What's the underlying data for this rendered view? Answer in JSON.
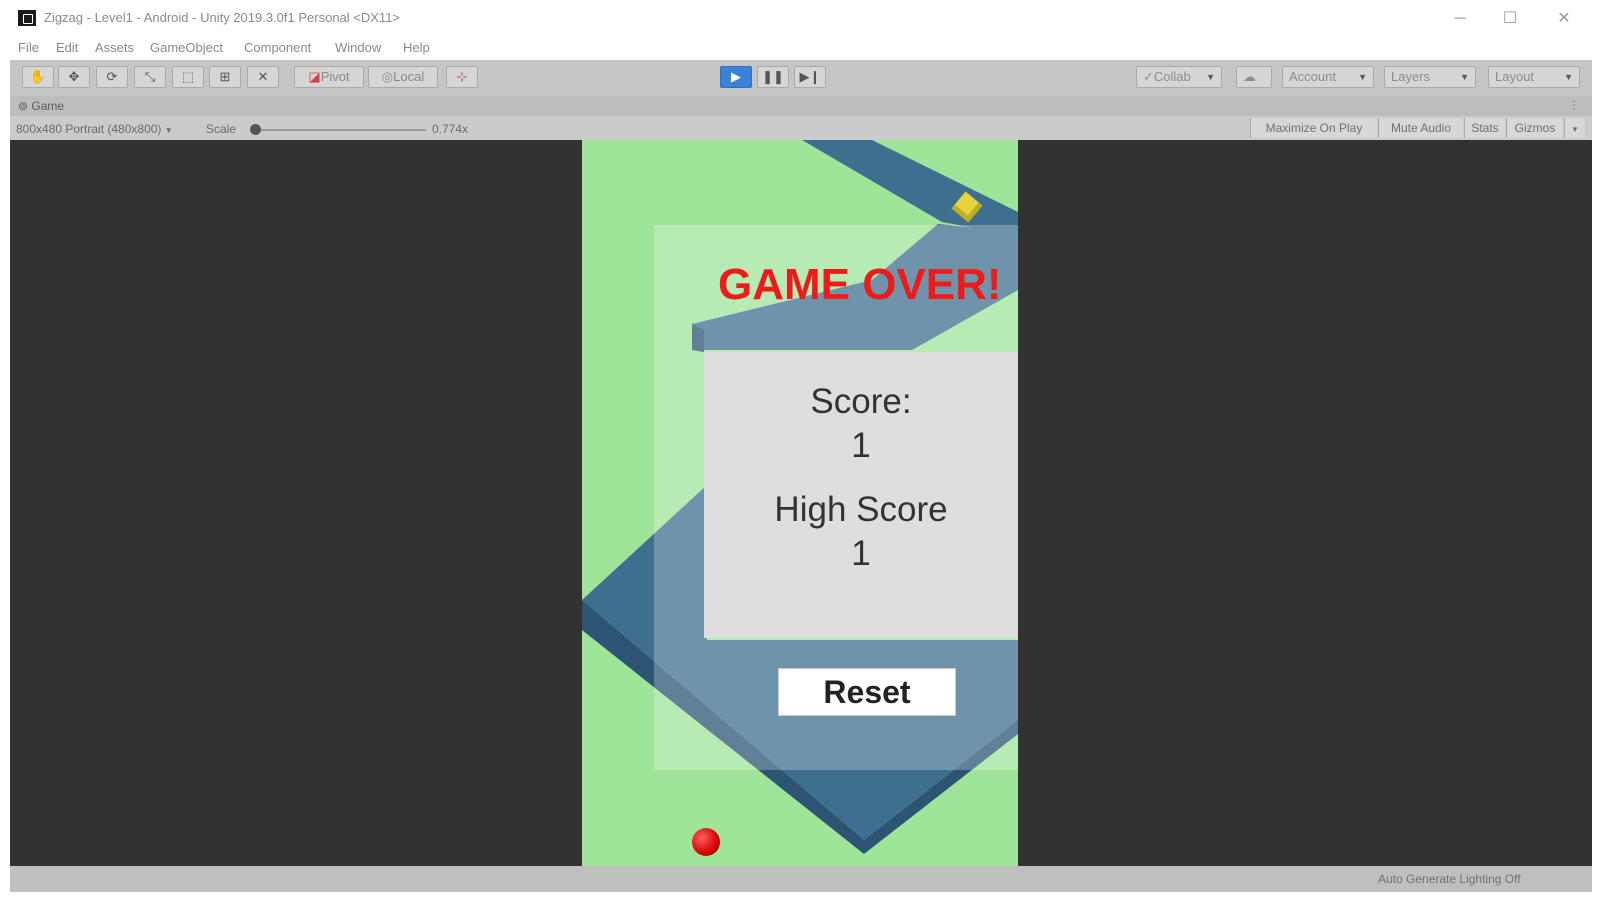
{
  "window": {
    "title": "Zigzag - Level1 - Android - Unity 2019.3.0f1 Personal <DX11>",
    "minimize": "─",
    "maximize": "☐",
    "close": "✕"
  },
  "menu": [
    "File",
    "Edit",
    "Assets",
    "GameObject",
    "Component",
    "Window",
    "Help"
  ],
  "toolbar": {
    "tools": [
      "hand-icon",
      "move-icon",
      "rotate-icon",
      "scale-icon",
      "rect-icon",
      "transform-icon",
      "custom-tool-icon"
    ],
    "pivot_label": "Pivot",
    "local_label": "Local",
    "collab_label": "Collab",
    "account_label": "Account",
    "layers_label": "Layers",
    "layout_label": "Layout",
    "play_active": true
  },
  "game_tab": {
    "label": "Game",
    "resolution": "800x480 Portrait (480x800)",
    "scale_label": "Scale",
    "scale_value": "0.774x",
    "maximize_on_play": "Maximize On Play",
    "mute_audio": "Mute Audio",
    "stats": "Stats",
    "gizmos": "Gizmos"
  },
  "game": {
    "game_over": "GAME OVER!",
    "score_label": "Score:",
    "score_value": "1",
    "high_score_label": "High Score",
    "high_score_value": "1",
    "reset_label": "Reset"
  },
  "status": {
    "text": "Auto Generate Lighting Off"
  }
}
